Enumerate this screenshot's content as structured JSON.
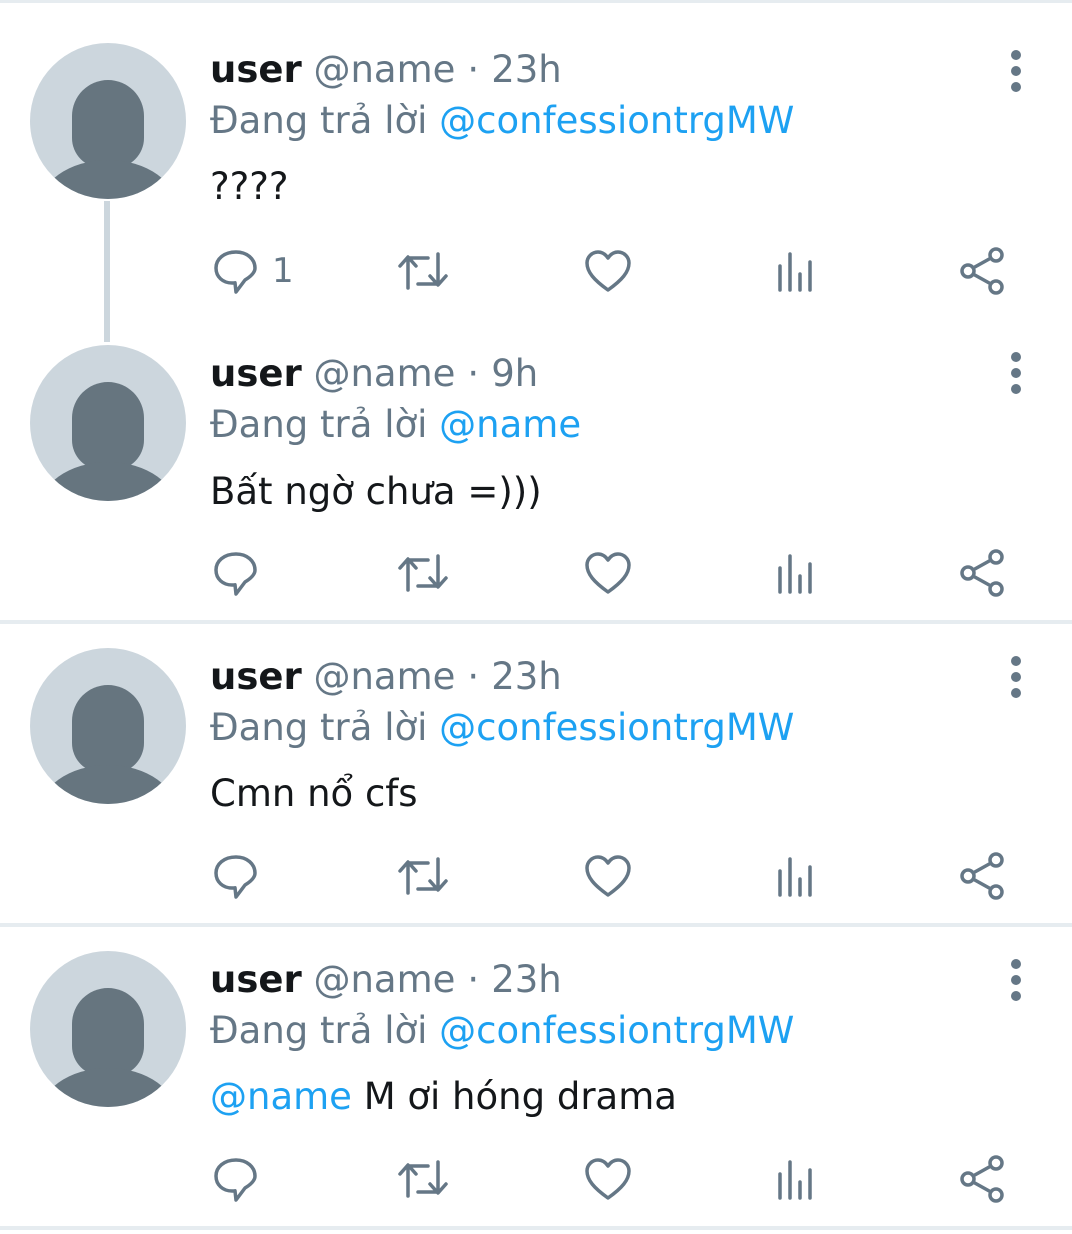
{
  "tweets": [
    {
      "name": "user",
      "handle": "@name",
      "separator": "·",
      "time": "23h",
      "replying_prefix": "Đang trả lời",
      "replying_to": "@confessiontrgMW",
      "text_mention": "",
      "text": "????",
      "reply_count": "1"
    },
    {
      "name": "user",
      "handle": "@name",
      "separator": "·",
      "time": "9h",
      "replying_prefix": "Đang trả lời",
      "replying_to": "@name",
      "text_mention": "",
      "text": "Bất ngờ chưa =)))",
      "reply_count": ""
    },
    {
      "name": "user",
      "handle": "@name",
      "separator": "·",
      "time": "23h",
      "replying_prefix": "Đang trả lời",
      "replying_to": "@confessiontrgMW",
      "text_mention": "",
      "text": "Cmn nổ cfs",
      "reply_count": ""
    },
    {
      "name": "user",
      "handle": "@name",
      "separator": "·",
      "time": "23h",
      "replying_prefix": "Đang trả lời",
      "replying_to": "@confessiontrgMW",
      "text_mention": "@name",
      "text": " M ơi hóng drama",
      "reply_count": ""
    }
  ],
  "icons": {
    "reply": "speech-bubble-icon",
    "retweet": "retweet-arrows-icon",
    "like": "heart-icon",
    "analytics": "bar-chart-icon",
    "share": "share-nodes-icon",
    "more": "vertical-dots-icon"
  },
  "colors": {
    "link": "#1da1f2",
    "secondary_text": "#657786",
    "avatar_bg": "#ccd6dd",
    "avatar_fg": "#66757f",
    "divider": "#e6ecf0"
  }
}
